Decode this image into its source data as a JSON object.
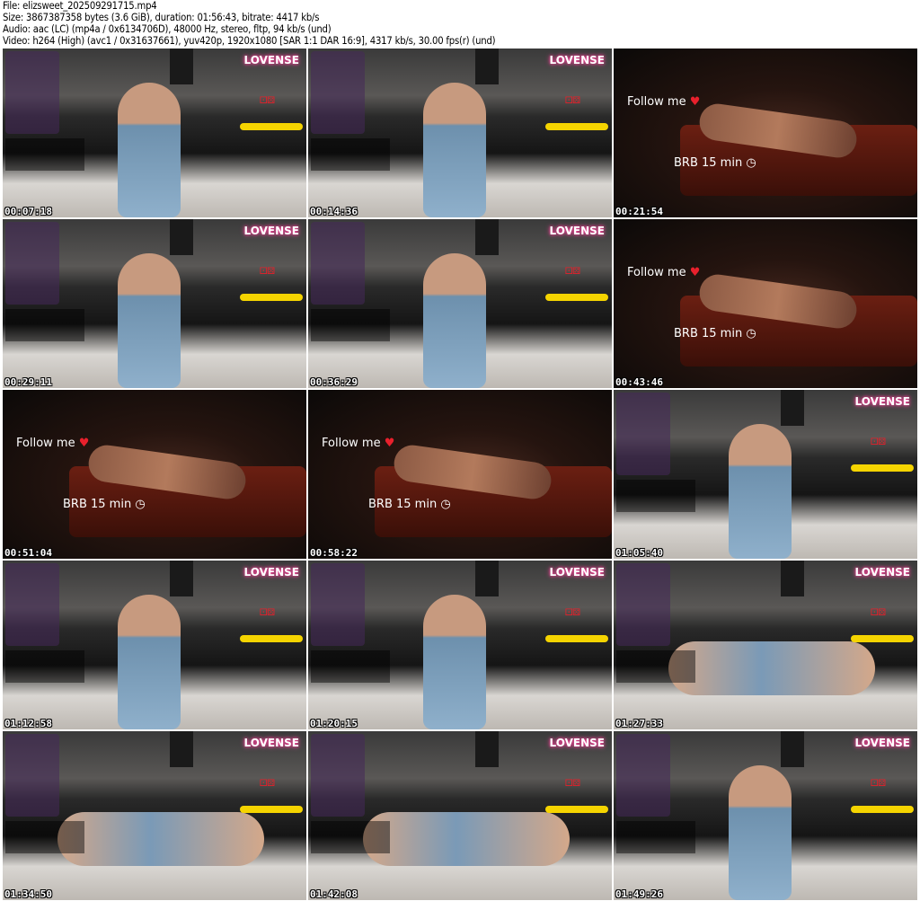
{
  "header": {
    "file": "File: elizsweet_202509291715.mp4",
    "size": "Size: 3867387358 bytes (3.6 GiB), duration: 01:56:43, bitrate: 4417 kb/s",
    "audio": "Audio: aac (LC) (mp4a / 0x6134706D), 48000 Hz, stereo, fltp, 94 kb/s (und)",
    "video": "Video: h264 (High) (avc1 / 0x31637661), yuv420p, 1920x1080 [SAR 1:1 DAR 16:9], 4317 kb/s, 30.00 fps(r) (und)"
  },
  "overlay": {
    "brand": "LOVENSE",
    "follow": "Follow me",
    "heart": "♥",
    "brb": "BRB 15 min",
    "clock": "◷"
  },
  "frames": [
    {
      "timestamp": "00:07:18",
      "kind": "sitting"
    },
    {
      "timestamp": "00:14:36",
      "kind": "sitting"
    },
    {
      "timestamp": "00:21:54",
      "kind": "brb"
    },
    {
      "timestamp": "00:29:11",
      "kind": "sitting"
    },
    {
      "timestamp": "00:36:29",
      "kind": "sitting"
    },
    {
      "timestamp": "00:43:46",
      "kind": "brb"
    },
    {
      "timestamp": "00:51:04",
      "kind": "brb"
    },
    {
      "timestamp": "00:58:22",
      "kind": "brb"
    },
    {
      "timestamp": "01:05:40",
      "kind": "sitting"
    },
    {
      "timestamp": "01:12:58",
      "kind": "sitting"
    },
    {
      "timestamp": "01:20:15",
      "kind": "sitting"
    },
    {
      "timestamp": "01:27:33",
      "kind": "lying"
    },
    {
      "timestamp": "01:34:50",
      "kind": "lying"
    },
    {
      "timestamp": "01:42:08",
      "kind": "lying"
    },
    {
      "timestamp": "01:49:26",
      "kind": "sitting"
    }
  ]
}
